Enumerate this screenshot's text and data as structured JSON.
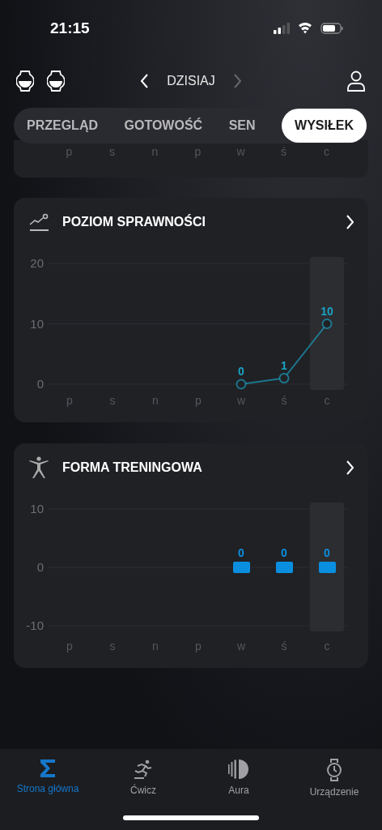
{
  "status_bar": {
    "time": "21:15"
  },
  "header": {
    "date_label": "DZISIAJ"
  },
  "tabs": [
    {
      "label": "PRZEGLĄD",
      "selected": false
    },
    {
      "label": "GOTOWOŚĆ",
      "selected": false
    },
    {
      "label": "SEN",
      "selected": false
    },
    {
      "label": "WYSIŁEK",
      "selected": true
    }
  ],
  "partial_card": {
    "days": [
      "p",
      "s",
      "n",
      "p",
      "w",
      "ś",
      "c"
    ]
  },
  "cards": [
    {
      "title": "POZIOM SPRAWNOŚCI",
      "kind": "trend",
      "chart_data": {
        "type": "line",
        "categories": [
          "p",
          "s",
          "n",
          "p",
          "w",
          "ś",
          "c"
        ],
        "series": [
          {
            "color": "#1aa3c4",
            "marker": "circle",
            "values": [
              null,
              null,
              null,
              null,
              0,
              1,
              10
            ]
          }
        ],
        "ylim": [
          0,
          20
        ],
        "yticks": [
          0,
          10,
          20
        ],
        "data_labels": true
      }
    },
    {
      "title": "FORMA TRENINGOWA",
      "kind": "figure",
      "chart_data": {
        "type": "bar",
        "categories": [
          "p",
          "s",
          "n",
          "p",
          "w",
          "ś",
          "c"
        ],
        "series": [
          {
            "color": "#0a8fe0",
            "values": [
              null,
              null,
              null,
              null,
              0,
              0,
              0
            ]
          }
        ],
        "ylim": [
          -10,
          10
        ],
        "yticks": [
          -10,
          0,
          10
        ],
        "data_labels": true
      }
    }
  ],
  "bottom_nav": [
    {
      "label": "Strona główna",
      "kind": "sigma",
      "selected": true
    },
    {
      "label": "Ćwicz",
      "kind": "run",
      "selected": false
    },
    {
      "label": "Aura",
      "kind": "aura",
      "selected": false
    },
    {
      "label": "Urządzenie",
      "kind": "watch",
      "selected": false
    }
  ]
}
